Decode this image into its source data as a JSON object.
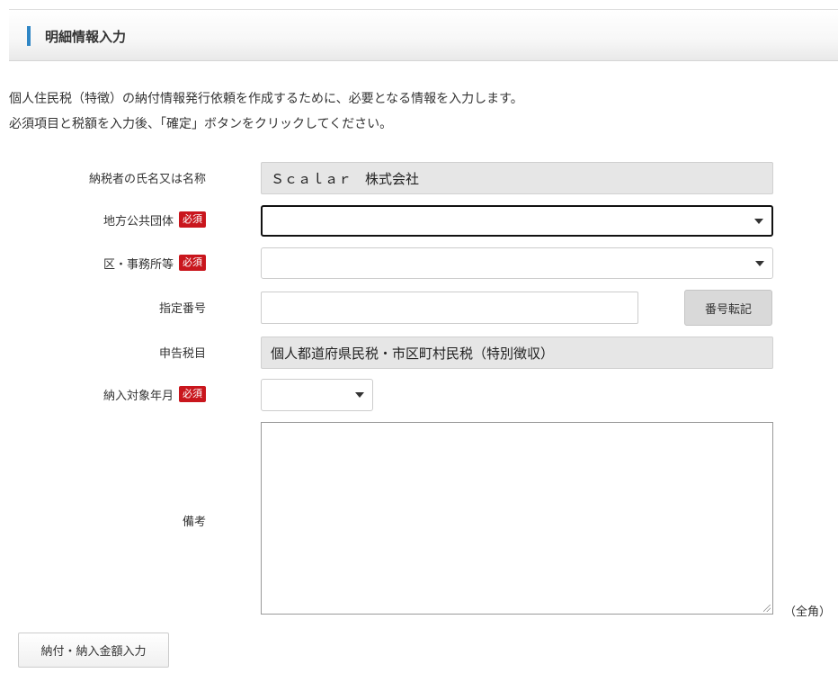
{
  "header": {
    "title": "明細情報入力"
  },
  "intro": {
    "line1": "個人住民税（特徴）の納付情報発行依頼を作成するために、必要となる情報を入力します。",
    "line2": "必須項目と税額を入力後、「確定」ボタンをクリックしてください。"
  },
  "form": {
    "required_badge": "必須",
    "taxpayer": {
      "label": "納税者の氏名又は名称",
      "value": "Ｓｃａｌａｒ　株式会社"
    },
    "municipality": {
      "label": "地方公共団体",
      "value": ""
    },
    "ward": {
      "label": "区・事務所等",
      "value": ""
    },
    "designated_number": {
      "label": "指定番号",
      "value": "",
      "transfer_button": "番号転記"
    },
    "tax_item": {
      "label": "申告税目",
      "value": "個人都道府県民税・市区町村民税（特別徴収）"
    },
    "target_month": {
      "label": "納入対象年月",
      "value": ""
    },
    "remarks": {
      "label": "備考",
      "value": "",
      "note": "（全角）"
    }
  },
  "footer": {
    "amount_button": "納付・納入金額入力"
  },
  "colors": {
    "accent": "#2f86c5",
    "required": "#c9161d"
  }
}
